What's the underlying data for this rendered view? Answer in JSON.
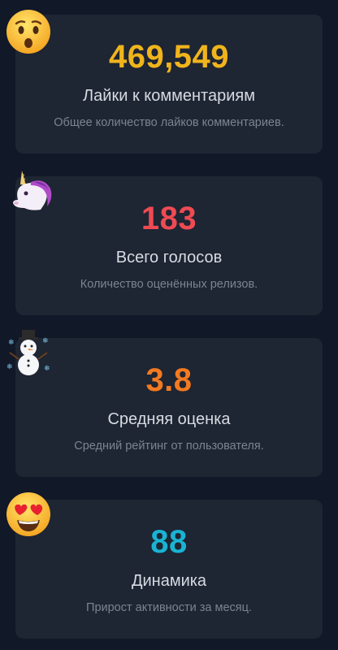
{
  "colors": {
    "background": "#111827",
    "card": "#1e2533",
    "likes": "#f0b41c",
    "votes": "#ef4a53",
    "rating": "#f47a20",
    "dynamics": "#19b4d3"
  },
  "stats": [
    {
      "icon": "hushed-face-emoji-icon",
      "value": "469,549",
      "title": "Лайки к комментариям",
      "description": "Общее количество лайков комментариев."
    },
    {
      "icon": "unicorn-emoji-icon",
      "value": "183",
      "title": "Всего голосов",
      "description": "Количество оценённых релизов."
    },
    {
      "icon": "snowman-emoji-icon",
      "value": "3.8",
      "title": "Средняя оценка",
      "description": "Средний рейтинг от пользователя."
    },
    {
      "icon": "heart-eyes-face-emoji-icon",
      "value": "88",
      "title": "Динамика",
      "description": "Прирост активности за месяц."
    }
  ]
}
